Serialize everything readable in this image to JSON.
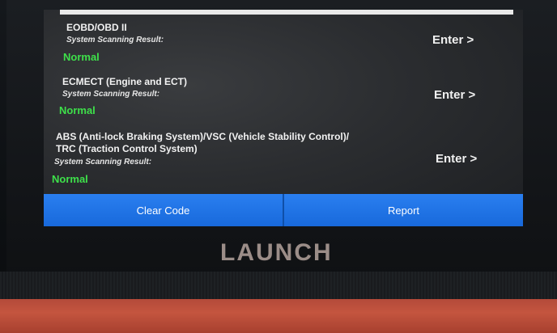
{
  "systems": [
    {
      "name_line1": "EOBD/OBD II",
      "name_line2": "",
      "result_label": "System Scanning Result:",
      "status": "Normal",
      "enter_label": "Enter >"
    },
    {
      "name_line1": "ECMECT (Engine and ECT)",
      "name_line2": "",
      "result_label": "System Scanning Result:",
      "status": "Normal",
      "enter_label": "Enter >"
    },
    {
      "name_line1": "ABS (Anti-lock Braking System)/VSC (Vehicle Stability Control)/",
      "name_line2": "TRC (Traction Control System)",
      "result_label": "System Scanning Result:",
      "status": "Normal",
      "enter_label": "Enter >"
    }
  ],
  "bottom_bar": {
    "clear_code_label": "Clear Code",
    "report_label": "Report"
  },
  "brand": {
    "logo_text": "LAUNCH"
  },
  "colors": {
    "status_normal": "#3ee04a",
    "button_blue": "#1f74e6",
    "table_red": "#b84b39"
  }
}
